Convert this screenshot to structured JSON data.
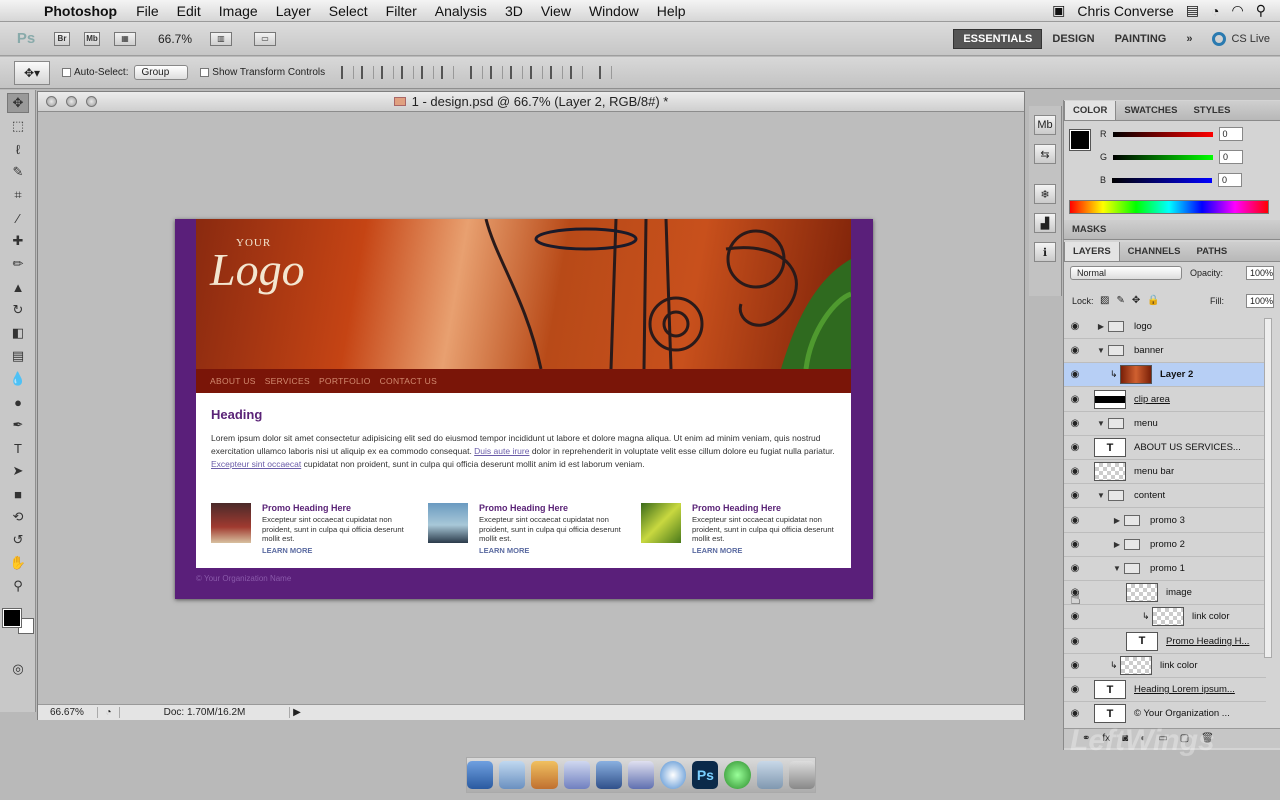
{
  "menubar": {
    "app": "Photoshop",
    "items": [
      "File",
      "Edit",
      "Image",
      "Layer",
      "Select",
      "Filter",
      "Analysis",
      "3D",
      "View",
      "Window",
      "Help"
    ],
    "user": "Chris Converse"
  },
  "appbar": {
    "ps_label": "Ps",
    "br": "Br",
    "mb": "Mb",
    "zoom": "66.7%",
    "workspaces": [
      "ESSENTIALS",
      "DESIGN",
      "PAINTING"
    ],
    "more": "»",
    "cslive": "CS Live"
  },
  "options": {
    "auto_select": "Auto-Select:",
    "group": "Group",
    "show_transform": "Show Transform Controls"
  },
  "document": {
    "title": "1 - design.psd @ 66.7% (Layer 2, RGB/8#) *",
    "status_zoom": "66.67%",
    "doc_size": "Doc: 1.70M/16.2M"
  },
  "design": {
    "logo_your": "YOUR",
    "logo_text": "Logo",
    "menu": [
      "ABOUT US",
      "SERVICES",
      "PORTFOLIO",
      "CONTACT US"
    ],
    "heading": "Heading",
    "para1": "Lorem ipsum dolor sit amet consectetur adipisicing elit sed do eiusmod tempor incididunt ut labore et dolore magna aliqua. Ut enim ad minim veniam, quis nostrud exercitation ullamco laboris nisi ut aliquip ex ea commodo consequat. ",
    "link1": "Duis aute irure",
    "para2": " dolor in reprehenderit in voluptate velit esse cillum dolore eu fugiat nulla pariatur. ",
    "link2": "Excepteur sint occaecat",
    "para3": " cupidatat non proident, sunt in culpa qui officia deserunt mollit anim id est laborum veniam.",
    "promos": [
      {
        "heading": "Promo Heading Here",
        "text": "Excepteur sint occaecat cupidatat non proident, sunt in culpa qui officia deserunt mollit est.",
        "link": "LEARN MORE",
        "color": "#7a3a30"
      },
      {
        "heading": "Promo Heading Here",
        "text": "Excepteur sint occaecat cupidatat non proident, sunt in culpa qui officia deserunt mollit est.",
        "link": "LEARN MORE",
        "color": "#4a7a9a"
      },
      {
        "heading": "Promo Heading Here",
        "text": "Excepteur sint occaecat cupidatat non proident, sunt in culpa qui officia deserunt mollit est.",
        "link": "LEARN MORE",
        "color": "#6a8a2a"
      }
    ],
    "footer": "© Your Organization Name"
  },
  "panels": {
    "color_tabs": [
      "COLOR",
      "SWATCHES",
      "STYLES"
    ],
    "rgb": [
      {
        "ch": "R",
        "val": "0"
      },
      {
        "ch": "G",
        "val": "0"
      },
      {
        "ch": "B",
        "val": "0"
      }
    ],
    "masks": "MASKS",
    "layer_tabs": [
      "LAYERS",
      "CHANNELS",
      "PATHS"
    ],
    "blend": "Normal",
    "opacity_label": "Opacity:",
    "opacity": "100%",
    "lock_label": "Lock:",
    "fill_label": "Fill:",
    "fill": "100%",
    "layers": [
      {
        "name": "logo",
        "kind": "folder",
        "arrow": "▶",
        "indent": 0
      },
      {
        "name": "banner",
        "kind": "folder",
        "arrow": "▼",
        "indent": 0
      },
      {
        "name": "Layer 2",
        "kind": "image",
        "indent": 1,
        "selected": true,
        "clip": true
      },
      {
        "name": "clip area",
        "kind": "black",
        "indent": 0,
        "underline": true
      },
      {
        "name": "menu",
        "kind": "folder",
        "arrow": "▼",
        "indent": 0
      },
      {
        "name": "ABOUT US    SERVICES...",
        "kind": "text",
        "indent": 0
      },
      {
        "name": "menu bar",
        "kind": "checker",
        "indent": 0
      },
      {
        "name": "content",
        "kind": "folder",
        "arrow": "▼",
        "indent": 0
      },
      {
        "name": "promo 3",
        "kind": "folder",
        "arrow": "▶",
        "indent": 1
      },
      {
        "name": "promo 2",
        "kind": "folder",
        "arrow": "▶",
        "indent": 1
      },
      {
        "name": "promo 1",
        "kind": "folder",
        "arrow": "▼",
        "indent": 1
      },
      {
        "name": "image",
        "kind": "checker",
        "indent": 2
      },
      {
        "name": "link color",
        "kind": "checker",
        "indent": 3,
        "clip": true
      },
      {
        "name": "Promo Heading H...",
        "kind": "text",
        "indent": 2,
        "underline": true
      },
      {
        "name": "link color",
        "kind": "checker",
        "indent": 1,
        "clip": true
      },
      {
        "name": "Heading Lorem ipsum...",
        "kind": "text",
        "indent": 0,
        "underline": true
      },
      {
        "name": "© Your Organization ...",
        "kind": "text",
        "indent": 0
      }
    ]
  },
  "watermark": "LeftWings"
}
